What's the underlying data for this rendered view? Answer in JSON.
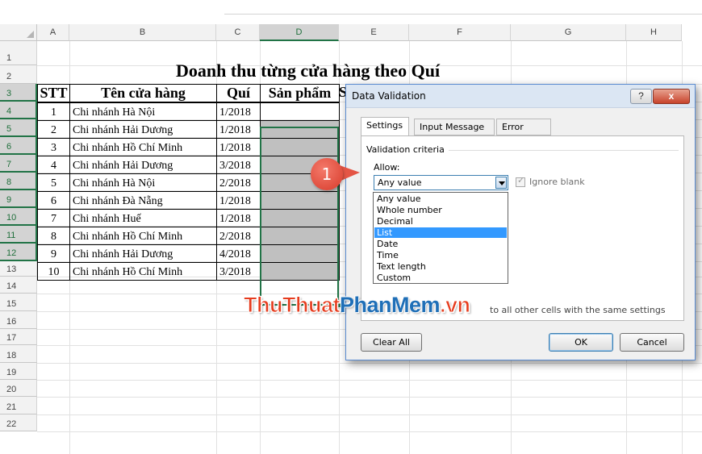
{
  "columns": [
    "A",
    "B",
    "C",
    "D",
    "E",
    "F",
    "G",
    "H"
  ],
  "rows": [
    "1",
    "2",
    "3",
    "4",
    "5",
    "6",
    "7",
    "8",
    "9",
    "10",
    "11",
    "12",
    "13",
    "14",
    "15",
    "16",
    "17",
    "18",
    "19",
    "20",
    "21",
    "22"
  ],
  "sheet": {
    "title": "Doanh thu từng cửa hàng theo Quí",
    "headers": [
      "STT",
      "Tên cửa hàng",
      "Quí",
      "Sản phẩm"
    ],
    "header_e_partial": "S",
    "data": [
      {
        "stt": "1",
        "name": "Chi nhánh Hà Nội",
        "quarter": "1/2018"
      },
      {
        "stt": "2",
        "name": "Chi nhánh Hải Dương",
        "quarter": "1/2018"
      },
      {
        "stt": "3",
        "name": "Chi nhánh Hồ Chí Minh",
        "quarter": "1/2018"
      },
      {
        "stt": "4",
        "name": "Chi nhánh Hải Dương",
        "quarter": "3/2018"
      },
      {
        "stt": "5",
        "name": "Chi nhánh Hà Nội",
        "quarter": "2/2018"
      },
      {
        "stt": "6",
        "name": "Chi nhánh Đà Nẵng",
        "quarter": "1/2018"
      },
      {
        "stt": "7",
        "name": "Chi nhánh Huế",
        "quarter": "1/2018"
      },
      {
        "stt": "8",
        "name": "Chi nhánh Hồ Chí Minh",
        "quarter": "2/2018"
      },
      {
        "stt": "9",
        "name": "Chi nhánh Hải Dương",
        "quarter": "4/2018"
      },
      {
        "stt": "10",
        "name": "Chi nhánh Hồ Chí Minh",
        "quarter": "3/2018"
      }
    ]
  },
  "dialog": {
    "title": "Data Validation",
    "help": "?",
    "close": "x",
    "tabs": [
      "Settings",
      "Input Message",
      "Error Alert"
    ],
    "group_label": "Validation criteria",
    "allow_label": "Allow:",
    "allow_value": "Any value",
    "ignore_blank": "Ignore blank",
    "apply_text": "to all other cells with the same settings",
    "options": [
      "Any value",
      "Whole number",
      "Decimal",
      "List",
      "Date",
      "Time",
      "Text length",
      "Custom"
    ],
    "selected_option": "List",
    "buttons": {
      "clear_all": "Clear All",
      "ok": "OK",
      "cancel": "Cancel"
    }
  },
  "callout": "1",
  "watermark": {
    "part1": "ThuThuat",
    "part2": "PhanMem",
    "part3": ".vn"
  },
  "colors": {
    "selection": "#217346",
    "highlight": "#3399ff",
    "callout": "#e45545",
    "gray_fill": "#c0c0c0"
  }
}
